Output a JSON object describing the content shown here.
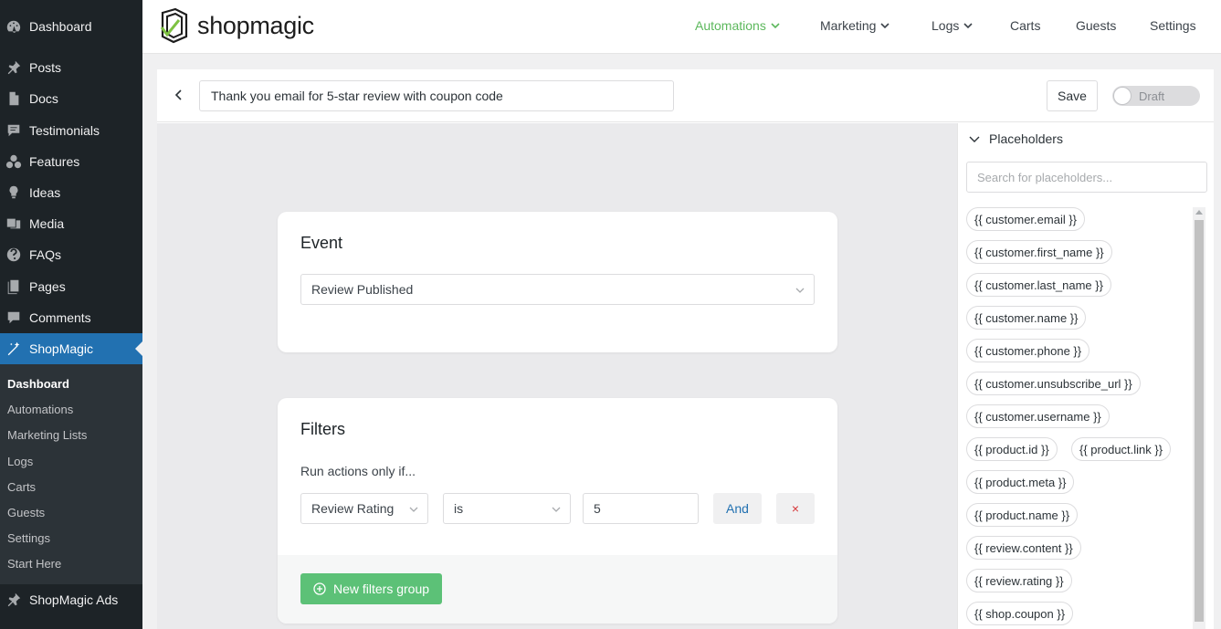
{
  "wp_menu": {
    "items": [
      {
        "label": "Dashboard",
        "icon": "dashboard-icon"
      },
      {
        "label": "Posts",
        "icon": "pin-icon"
      },
      {
        "label": "Docs",
        "icon": "document-icon"
      },
      {
        "label": "Testimonials",
        "icon": "testimonial-icon"
      },
      {
        "label": "Features",
        "icon": "features-icon"
      },
      {
        "label": "Ideas",
        "icon": "lightbulb-icon"
      },
      {
        "label": "Media",
        "icon": "media-icon"
      },
      {
        "label": "FAQs",
        "icon": "help-icon"
      },
      {
        "label": "Pages",
        "icon": "pages-icon"
      },
      {
        "label": "Comments",
        "icon": "comment-icon"
      },
      {
        "label": "ShopMagic",
        "icon": "magic-wand-icon"
      },
      {
        "label": "ShopMagic Ads",
        "icon": "pin-icon"
      }
    ],
    "submenu": [
      "Dashboard",
      "Automations",
      "Marketing Lists",
      "Logs",
      "Carts",
      "Guests",
      "Settings",
      "Start Here"
    ],
    "active_color": "#2271b1"
  },
  "header": {
    "logo_text": "shopmagic",
    "nav": [
      "Automations",
      "Marketing",
      "Logs",
      "Carts",
      "Guests",
      "Settings"
    ],
    "accent": "#5cb85c"
  },
  "automation": {
    "name": "Thank you email for 5-star review with coupon code",
    "save_label": "Save",
    "status_label": "Draft"
  },
  "event_card": {
    "title": "Event",
    "selected": "Review Published"
  },
  "filters_card": {
    "title": "Filters",
    "hint": "Run actions only if...",
    "field": "Review Rating",
    "operator": "is",
    "value": "5",
    "and_label": "And",
    "remove_label": "×",
    "new_group_label": "New filters group",
    "button_color": "#5cc177"
  },
  "placeholders": {
    "title": "Placeholders",
    "search_placeholder": "Search for placeholders...",
    "items": [
      "{{ customer.email }}",
      "{{ customer.first_name }}",
      "{{ customer.last_name }}",
      "{{ customer.name }}",
      "{{ customer.phone }}",
      "{{ customer.unsubscribe_url }}",
      "{{ customer.username }}",
      "{{ product.id }}",
      "{{ product.link }}",
      "{{ product.meta }}",
      "{{ product.name }}",
      "{{ review.content }}",
      "{{ review.rating }}",
      "{{ shop.coupon }}"
    ]
  }
}
